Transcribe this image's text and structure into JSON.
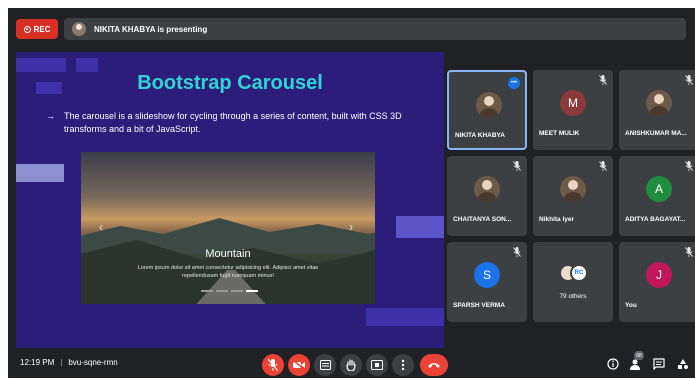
{
  "top": {
    "rec_label": "REC",
    "presenting_text": "NIKITA KHABYA is presenting"
  },
  "slide": {
    "title": "Bootstrap Carousel",
    "bullet": "The carousel is a slideshow for cycling through a series of content, built with CSS 3D transforms and a bit of JavaScript.",
    "caption_title": "Mountain",
    "caption_text": "Lorem ipsum dolor sit amet consectetur adipisicing elit. Adipisci amet vitae repellendusam fugit numquam minus!"
  },
  "participants": [
    {
      "name": "NIKITA KHABYA",
      "type": "photo",
      "active": true,
      "speaking": true
    },
    {
      "name": "MEET MULIK",
      "initial": "M",
      "color": "#8b3a3a",
      "muted": true
    },
    {
      "name": "ANISHKUMAR MA...",
      "type": "photo",
      "muted": true
    },
    {
      "name": "CHAITANYA SON...",
      "type": "photo",
      "muted": true
    },
    {
      "name": "Nikhita Iyer",
      "type": "photo",
      "muted": true
    },
    {
      "name": "ADITYA BAGAYAT...",
      "initial": "A",
      "color": "#1e8e3e",
      "muted": true
    },
    {
      "name": "SPARSH VERMA",
      "initial": "S",
      "color": "#1a73e8",
      "muted": true
    },
    {
      "name": "79 others",
      "type": "others"
    },
    {
      "name": "You",
      "initial": "J",
      "color": "#c2185b",
      "muted": true
    }
  ],
  "others_badge": "RC",
  "bottom": {
    "time": "12:19 PM",
    "meeting_code": "bvu-sqne-rmn",
    "participant_count": "88"
  }
}
